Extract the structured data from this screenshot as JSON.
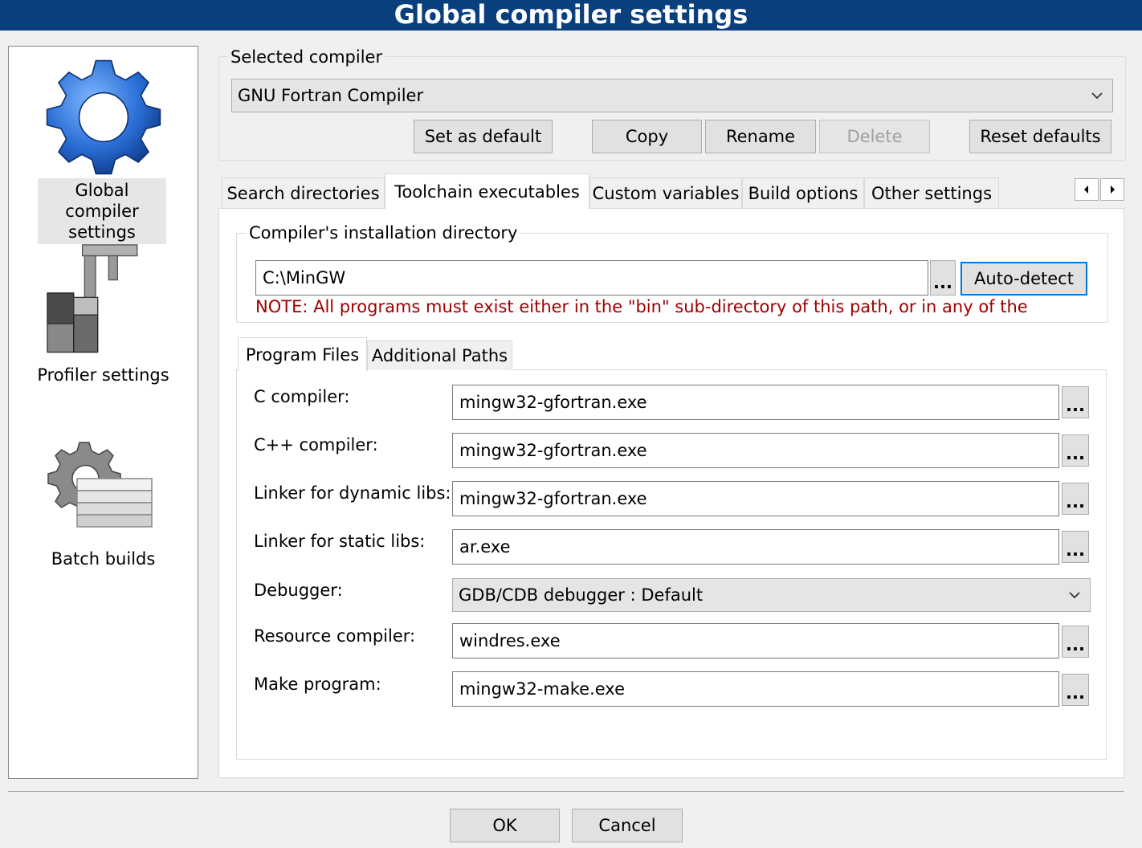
{
  "window": {
    "title": "Global compiler settings"
  },
  "sidebar": {
    "items": [
      {
        "label": "Global compiler settings",
        "icon": "gear-icon",
        "selected": true
      },
      {
        "label": "Profiler settings",
        "icon": "caliper-icon",
        "selected": false
      },
      {
        "label": "Batch builds",
        "icon": "gear-stack-icon",
        "selected": false
      }
    ]
  },
  "selected_compiler": {
    "caption": "Selected compiler",
    "value": "GNU Fortran Compiler",
    "buttons": {
      "set_default": "Set as default",
      "copy": "Copy",
      "rename": "Rename",
      "delete": "Delete",
      "reset": "Reset defaults"
    }
  },
  "tabs": [
    {
      "label": "Search directories",
      "active": false
    },
    {
      "label": "Toolchain executables",
      "active": true
    },
    {
      "label": "Custom variables",
      "active": false
    },
    {
      "label": "Build options",
      "active": false
    },
    {
      "label": "Other settings",
      "active": false
    }
  ],
  "install_dir": {
    "caption": "Compiler's installation directory",
    "value": "C:\\MinGW",
    "browse_label": "...",
    "autodetect_label": "Auto-detect",
    "note": "NOTE: All programs must exist either in the \"bin\" sub-directory of this path, or in any of the"
  },
  "subtabs": [
    {
      "label": "Program Files",
      "active": true
    },
    {
      "label": "Additional Paths",
      "active": false
    }
  ],
  "programs": {
    "c_compiler": {
      "label": "C compiler:",
      "value": "mingw32-gfortran.exe"
    },
    "cpp_compiler": {
      "label": "C++ compiler:",
      "value": "mingw32-gfortran.exe"
    },
    "linker_dynamic": {
      "label": "Linker for dynamic libs:",
      "value": "mingw32-gfortran.exe"
    },
    "linker_static": {
      "label": "Linker for static libs:",
      "value": "ar.exe"
    },
    "debugger": {
      "label": "Debugger:",
      "value": "GDB/CDB debugger : Default"
    },
    "resource_compiler": {
      "label": "Resource compiler:",
      "value": "windres.exe"
    },
    "make_program": {
      "label": "Make program:",
      "value": "mingw32-make.exe"
    },
    "browse_label": "..."
  },
  "footer": {
    "ok": "OK",
    "cancel": "Cancel"
  },
  "colors": {
    "titlebar": "#0a3f7e",
    "note": "#a00000",
    "focus": "#0078d7"
  }
}
